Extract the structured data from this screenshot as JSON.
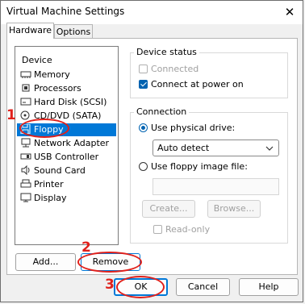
{
  "window": {
    "title": "Virtual Machine Settings"
  },
  "tabs": [
    {
      "label": "Hardware"
    },
    {
      "label": "Options"
    }
  ],
  "device_list": {
    "header": "Device",
    "items": [
      {
        "label": "Memory",
        "icon": "memory-icon"
      },
      {
        "label": "Processors",
        "icon": "cpu-icon"
      },
      {
        "label": "Hard Disk (SCSI)",
        "icon": "hard-disk-icon"
      },
      {
        "label": "CD/DVD (SATA)",
        "icon": "cd-icon"
      },
      {
        "label": "Floppy",
        "icon": "floppy-icon",
        "selected": true
      },
      {
        "label": "Network Adapter",
        "icon": "network-icon"
      },
      {
        "label": "USB Controller",
        "icon": "usb-icon"
      },
      {
        "label": "Sound Card",
        "icon": "speaker-icon"
      },
      {
        "label": "Printer",
        "icon": "printer-icon"
      },
      {
        "label": "Display",
        "icon": "monitor-icon"
      }
    ]
  },
  "device_status": {
    "title": "Device status",
    "connected": "Connected",
    "connect_at_power_on": "Connect at power on"
  },
  "connection": {
    "title": "Connection",
    "use_physical_drive": "Use physical drive:",
    "drive_value": "Auto detect",
    "use_floppy_image": "Use floppy image file:",
    "create": "Create...",
    "browse": "Browse...",
    "read_only": "Read-only"
  },
  "panel_buttons": {
    "add": "Add...",
    "remove": "Remove"
  },
  "dialog_buttons": {
    "ok": "OK",
    "cancel": "Cancel",
    "help": "Help"
  },
  "annotations": [
    "1",
    "2",
    "3"
  ],
  "colors": {
    "selection": "#0078d7",
    "annotation": "#e0201b",
    "accent": "#0063b1"
  }
}
